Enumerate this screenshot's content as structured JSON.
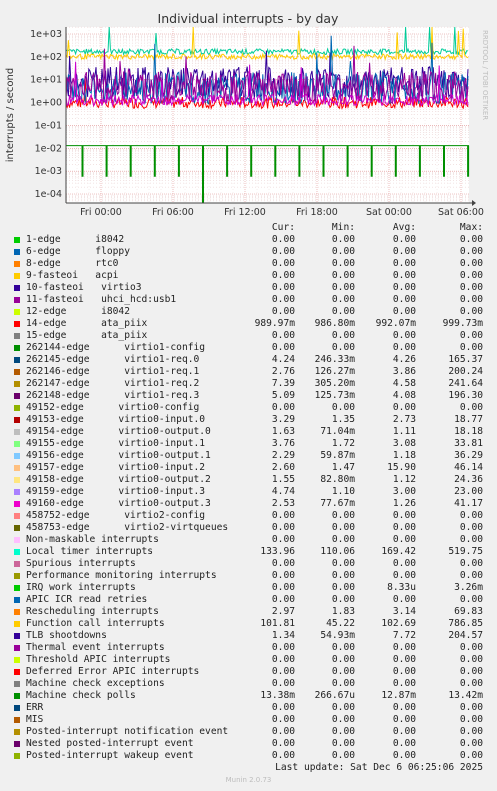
{
  "chart_data": {
    "type": "line",
    "title": "Individual interrupts - by day",
    "ylabel": "interrupts / second",
    "yscale": "log",
    "ylim": [
      5e-05,
      1000
    ],
    "ytick_labels": [
      "1e+03",
      "1e+02",
      "1e+01",
      "1e+00",
      "1e-01",
      "1e-02",
      "1e-03",
      "1e-04"
    ],
    "xtick_labels": [
      "Fri 00:00",
      "Fri 06:00",
      "Fri 12:00",
      "Fri 18:00",
      "Sat 00:00",
      "Sat 06:00"
    ],
    "side_label": "RRDTOOL / TOBI OETIKER",
    "grid": true,
    "series_shown": [
      {
        "name": "14-edge ata_piix",
        "level": 0.99,
        "color": "#FF0000"
      },
      {
        "name": "Local timer interrupts",
        "level": 169,
        "color": "#00CC99"
      },
      {
        "name": "Function call interrupts",
        "level": 103,
        "color": "#FFCC00"
      },
      {
        "name": "TLB shootdowns",
        "level": 7.7,
        "color": "#330099"
      },
      {
        "name": "262145-edge virtio1-req.0",
        "level": 4.3,
        "color": "#0066B3"
      },
      {
        "name": "262147-edge virtio1-req.2",
        "level": 4.6,
        "color": "#990099"
      },
      {
        "name": "49160-edge virtio0-output.3",
        "level": 1.3,
        "color": "#CC00CC"
      },
      {
        "name": "Machine check polls",
        "spike_level": 0.013,
        "color": "#008F00"
      }
    ]
  },
  "legend": {
    "headers": {
      "cur": "Cur:",
      "min": "Min:",
      "avg": "Avg:",
      "max": "Max:"
    },
    "rows": [
      {
        "label": "1-edge      i8042",
        "color": "#00cc00",
        "cur": "0.00",
        "min": "0.00",
        "avg": "0.00",
        "max": "0.00"
      },
      {
        "label": "6-edge      floppy",
        "color": "#0066b3",
        "cur": "0.00",
        "min": "0.00",
        "avg": "0.00",
        "max": "0.00"
      },
      {
        "label": "8-edge      rtc0",
        "color": "#ff8000",
        "cur": "0.00",
        "min": "0.00",
        "avg": "0.00",
        "max": "0.00"
      },
      {
        "label": "9-fasteoi   acpi",
        "color": "#ffcc00",
        "cur": "0.00",
        "min": "0.00",
        "avg": "0.00",
        "max": "0.00"
      },
      {
        "label": "10-fasteoi   virtio3",
        "color": "#330099",
        "cur": "0.00",
        "min": "0.00",
        "avg": "0.00",
        "max": "0.00"
      },
      {
        "label": "11-fasteoi   uhci_hcd:usb1",
        "color": "#990099",
        "cur": "0.00",
        "min": "0.00",
        "avg": "0.00",
        "max": "0.00"
      },
      {
        "label": "12-edge      i8042",
        "color": "#ccff00",
        "cur": "0.00",
        "min": "0.00",
        "avg": "0.00",
        "max": "0.00"
      },
      {
        "label": "14-edge      ata_piix",
        "color": "#ff0000",
        "cur": "989.97m",
        "min": "986.80m",
        "avg": "992.07m",
        "max": "999.73m"
      },
      {
        "label": "15-edge      ata_piix",
        "color": "#808080",
        "cur": "0.00",
        "min": "0.00",
        "avg": "0.00",
        "max": "0.00"
      },
      {
        "label": "262144-edge      virtio1-config",
        "color": "#008f00",
        "cur": "0.00",
        "min": "0.00",
        "avg": "0.00",
        "max": "0.00"
      },
      {
        "label": "262145-edge      virtio1-req.0",
        "color": "#00487d",
        "cur": "4.24",
        "min": "246.33m",
        "avg": "4.26",
        "max": "165.37"
      },
      {
        "label": "262146-edge      virtio1-req.1",
        "color": "#b35a00",
        "cur": "2.76",
        "min": "126.27m",
        "avg": "3.86",
        "max": "200.24"
      },
      {
        "label": "262147-edge      virtio1-req.2",
        "color": "#b38f00",
        "cur": "7.39",
        "min": "305.20m",
        "avg": "4.58",
        "max": "241.64"
      },
      {
        "label": "262148-edge      virtio1-req.3",
        "color": "#6b006b",
        "cur": "5.09",
        "min": "125.73m",
        "avg": "4.08",
        "max": "196.30"
      },
      {
        "label": "49152-edge      virtio0-config",
        "color": "#8fb300",
        "cur": "0.00",
        "min": "0.00",
        "avg": "0.00",
        "max": "0.00"
      },
      {
        "label": "49153-edge      virtio0-input.0",
        "color": "#b30000",
        "cur": "3.29",
        "min": "1.35",
        "avg": "2.73",
        "max": "18.77"
      },
      {
        "label": "49154-edge      virtio0-output.0",
        "color": "#bebebe",
        "cur": "1.63",
        "min": "71.04m",
        "avg": "1.11",
        "max": "18.18"
      },
      {
        "label": "49155-edge      virtio0-input.1",
        "color": "#80ff80",
        "cur": "3.76",
        "min": "1.72",
        "avg": "3.08",
        "max": "33.81"
      },
      {
        "label": "49156-edge      virtio0-output.1",
        "color": "#80c9ff",
        "cur": "2.29",
        "min": "59.87m",
        "avg": "1.18",
        "max": "36.29"
      },
      {
        "label": "49157-edge      virtio0-input.2",
        "color": "#ffc080",
        "cur": "2.60",
        "min": "1.47",
        "avg": "15.90",
        "max": "46.14"
      },
      {
        "label": "49158-edge      virtio0-output.2",
        "color": "#ffe680",
        "cur": "1.55",
        "min": "82.80m",
        "avg": "1.12",
        "max": "24.36"
      },
      {
        "label": "49159-edge      virtio0-input.3",
        "color": "#aa80ff",
        "cur": "4.74",
        "min": "1.10",
        "avg": "3.00",
        "max": "23.00"
      },
      {
        "label": "49160-edge      virtio0-output.3",
        "color": "#ee00cc",
        "cur": "2.53",
        "min": "77.67m",
        "avg": "1.26",
        "max": "41.17"
      },
      {
        "label": "458752-edge      virtio2-config",
        "color": "#ff8080",
        "cur": "0.00",
        "min": "0.00",
        "avg": "0.00",
        "max": "0.00"
      },
      {
        "label": "458753-edge      virtio2-virtqueues",
        "color": "#666600",
        "cur": "0.00",
        "min": "0.00",
        "avg": "0.00",
        "max": "0.00"
      },
      {
        "label": "Non-maskable interrupts",
        "color": "#ffbfff",
        "cur": "0.00",
        "min": "0.00",
        "avg": "0.00",
        "max": "0.00"
      },
      {
        "label": "Local timer interrupts",
        "color": "#00ffcc",
        "cur": "133.96",
        "min": "110.06",
        "avg": "169.42",
        "max": "519.75"
      },
      {
        "label": "Spurious interrupts",
        "color": "#cc6699",
        "cur": "0.00",
        "min": "0.00",
        "avg": "0.00",
        "max": "0.00"
      },
      {
        "label": "Performance monitoring interrupts",
        "color": "#999900",
        "cur": "0.00",
        "min": "0.00",
        "avg": "0.00",
        "max": "0.00"
      },
      {
        "label": "IRQ work interrupts",
        "color": "#00cc00",
        "cur": "0.00",
        "min": "0.00",
        "avg": "8.33u",
        "max": "3.26m"
      },
      {
        "label": "APIC ICR read retries",
        "color": "#0066b3",
        "cur": "0.00",
        "min": "0.00",
        "avg": "0.00",
        "max": "0.00"
      },
      {
        "label": "Rescheduling interrupts",
        "color": "#ff8000",
        "cur": "2.97",
        "min": "1.83",
        "avg": "3.14",
        "max": "69.83"
      },
      {
        "label": "Function call interrupts",
        "color": "#ffcc00",
        "cur": "101.81",
        "min": "45.22",
        "avg": "102.69",
        "max": "786.85"
      },
      {
        "label": "TLB shootdowns",
        "color": "#330099",
        "cur": "1.34",
        "min": "54.93m",
        "avg": "7.72",
        "max": "204.57"
      },
      {
        "label": "Thermal event interrupts",
        "color": "#990099",
        "cur": "0.00",
        "min": "0.00",
        "avg": "0.00",
        "max": "0.00"
      },
      {
        "label": "Threshold APIC interrupts",
        "color": "#ccff00",
        "cur": "0.00",
        "min": "0.00",
        "avg": "0.00",
        "max": "0.00"
      },
      {
        "label": "Deferred Error APIC interrupts",
        "color": "#ff0000",
        "cur": "0.00",
        "min": "0.00",
        "avg": "0.00",
        "max": "0.00"
      },
      {
        "label": "Machine check exceptions",
        "color": "#808080",
        "cur": "0.00",
        "min": "0.00",
        "avg": "0.00",
        "max": "0.00"
      },
      {
        "label": "Machine check polls",
        "color": "#008f00",
        "cur": "13.38m",
        "min": "266.67u",
        "avg": "12.87m",
        "max": "13.42m"
      },
      {
        "label": "ERR",
        "color": "#00487d",
        "cur": "0.00",
        "min": "0.00",
        "avg": "0.00",
        "max": "0.00"
      },
      {
        "label": "MIS",
        "color": "#b35a00",
        "cur": "0.00",
        "min": "0.00",
        "avg": "0.00",
        "max": "0.00"
      },
      {
        "label": "Posted-interrupt notification event",
        "color": "#b38f00",
        "cur": "0.00",
        "min": "0.00",
        "avg": "0.00",
        "max": "0.00"
      },
      {
        "label": "Nested posted-interrupt event",
        "color": "#6b006b",
        "cur": "0.00",
        "min": "0.00",
        "avg": "0.00",
        "max": "0.00"
      },
      {
        "label": "Posted-interrupt wakeup event",
        "color": "#8fb300",
        "cur": "0.00",
        "min": "0.00",
        "avg": "0.00",
        "max": "0.00"
      }
    ]
  },
  "footer": {
    "last_update": "Last update: Sat Dec  6 06:25:06 2025",
    "generator": "Munin 2.0.73"
  }
}
